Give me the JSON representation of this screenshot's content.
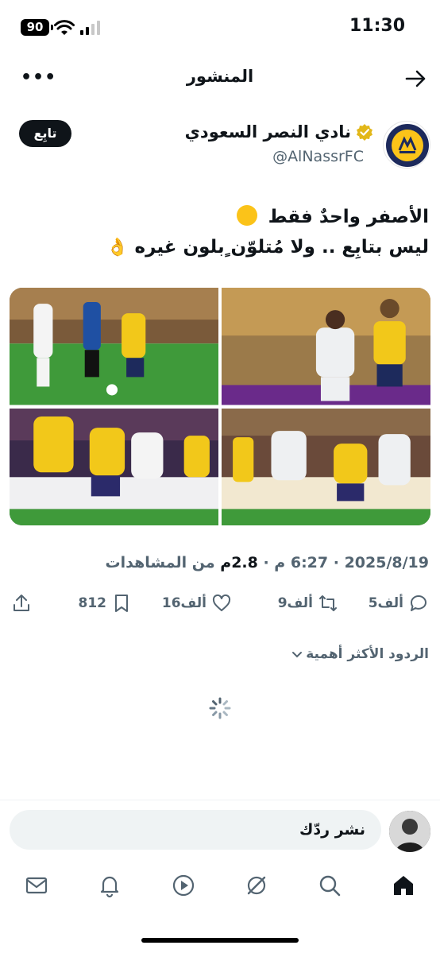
{
  "status": {
    "time": "11:30",
    "battery": "90"
  },
  "header": {
    "title": "المنشور"
  },
  "author": {
    "name": "نادي النصر السعودي",
    "handle": "@AlNassrFC",
    "follow_label": "تابِع"
  },
  "tweet": {
    "line1": "الأصفر واحدٌ فقط",
    "line2": "ليس بتابِع .. ولا مُتلوّن ٍبلون غيره",
    "hand_emoji": "👌"
  },
  "meta": {
    "date_time": "2025/8/19 · 6:27 م · ",
    "views_count": "2.8م",
    "views_label": " من المشاهدات"
  },
  "actions": {
    "replies": "5ألف",
    "reposts": "9ألف",
    "likes": "16ألف",
    "bookmarks": "812"
  },
  "replies_sort": {
    "label": "الردود الأكثر أهمية"
  },
  "composer": {
    "placeholder": "نشر ردّك"
  },
  "colors": {
    "accent_yellow": "#fbc319",
    "navy": "#1d2a5c",
    "text": "#0f1419",
    "muted": "#536471"
  },
  "icons": [
    "wifi-icon",
    "signal-icon",
    "more-icon",
    "back-arrow-icon",
    "verified-icon",
    "reply-icon",
    "repost-icon",
    "like-icon",
    "bookmark-icon",
    "share-icon",
    "chevron-down-icon",
    "spinner-icon",
    "mail-icon",
    "bell-icon",
    "play-icon",
    "grok-icon",
    "search-icon",
    "home-icon"
  ]
}
